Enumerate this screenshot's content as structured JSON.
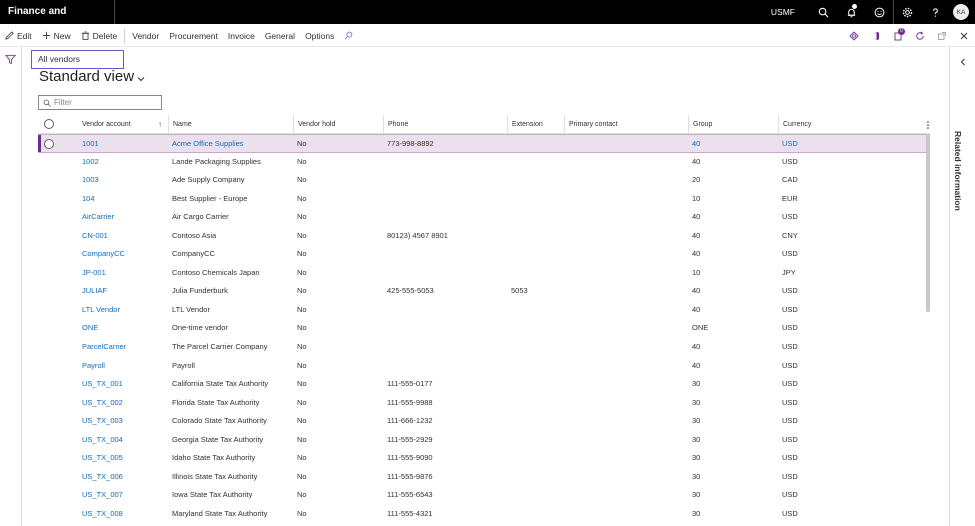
{
  "app": {
    "title": "Finance and Operations",
    "company": "USMF",
    "avatar_initials": "KA"
  },
  "actions": {
    "edit": "Edit",
    "new": "New",
    "delete": "Delete",
    "menus": [
      "Vendor",
      "Procurement",
      "Invoice",
      "General",
      "Options"
    ]
  },
  "view": {
    "name": "All vendors",
    "title": "Standard view",
    "filter_placeholder": "Filter"
  },
  "related_info": "Related information",
  "grid": {
    "columns": [
      "Vendor account",
      "Name",
      "Vendor hold",
      "Phone",
      "Extension",
      "Primary contact",
      "Group",
      "Currency"
    ],
    "rows": [
      {
        "account": "1001",
        "name": "Acme Office Supplies",
        "hold": "No",
        "phone": "773-998-8892",
        "ext": "",
        "contact": "",
        "group": "40",
        "currency": "USD"
      },
      {
        "account": "1002",
        "name": "Lande Packaging Supplies",
        "hold": "No",
        "phone": "",
        "ext": "",
        "contact": "",
        "group": "40",
        "currency": "USD"
      },
      {
        "account": "1003",
        "name": "Ade Supply Company",
        "hold": "No",
        "phone": "",
        "ext": "",
        "contact": "",
        "group": "20",
        "currency": "CAD"
      },
      {
        "account": "104",
        "name": "Best Supplier - Europe",
        "hold": "No",
        "phone": "",
        "ext": "",
        "contact": "",
        "group": "10",
        "currency": "EUR"
      },
      {
        "account": "AirCarrier",
        "name": "Air Cargo Carrier",
        "hold": "No",
        "phone": "",
        "ext": "",
        "contact": "",
        "group": "40",
        "currency": "USD"
      },
      {
        "account": "CN-001",
        "name": "Contoso Asia",
        "hold": "No",
        "phone": "80123) 4567 8901",
        "ext": "",
        "contact": "",
        "group": "40",
        "currency": "CNY"
      },
      {
        "account": "CompanyCC",
        "name": "CompanyCC",
        "hold": "No",
        "phone": "",
        "ext": "",
        "contact": "",
        "group": "40",
        "currency": "USD"
      },
      {
        "account": "JP-001",
        "name": "Contoso Chemicals Japan",
        "hold": "No",
        "phone": "",
        "ext": "",
        "contact": "",
        "group": "10",
        "currency": "JPY"
      },
      {
        "account": "JULIAF",
        "name": "Julia Funderburk",
        "hold": "No",
        "phone": "425-555-5053",
        "ext": "5053",
        "contact": "",
        "group": "40",
        "currency": "USD"
      },
      {
        "account": "LTL Vendor",
        "name": "LTL Vendor",
        "hold": "No",
        "phone": "",
        "ext": "",
        "contact": "",
        "group": "40",
        "currency": "USD"
      },
      {
        "account": "ONE",
        "name": "One-time vendor",
        "hold": "No",
        "phone": "",
        "ext": "",
        "contact": "",
        "group": "ONE",
        "currency": "USD"
      },
      {
        "account": "ParcelCarrier",
        "name": "The Parcel Carrier Company",
        "hold": "No",
        "phone": "",
        "ext": "",
        "contact": "",
        "group": "40",
        "currency": "USD"
      },
      {
        "account": "Payroll",
        "name": "Payroll",
        "hold": "No",
        "phone": "",
        "ext": "",
        "contact": "",
        "group": "40",
        "currency": "USD"
      },
      {
        "account": "US_TX_001",
        "name": "California State Tax Authority",
        "hold": "No",
        "phone": "111-555-0177",
        "ext": "",
        "contact": "",
        "group": "30",
        "currency": "USD"
      },
      {
        "account": "US_TX_002",
        "name": "Florida State Tax Authority",
        "hold": "No",
        "phone": "111-555-9988",
        "ext": "",
        "contact": "",
        "group": "30",
        "currency": "USD"
      },
      {
        "account": "US_TX_003",
        "name": "Colorado State Tax Authority",
        "hold": "No",
        "phone": "111-666-1232",
        "ext": "",
        "contact": "",
        "group": "30",
        "currency": "USD"
      },
      {
        "account": "US_TX_004",
        "name": "Georgia State Tax Authority",
        "hold": "No",
        "phone": "111-555-2929",
        "ext": "",
        "contact": "",
        "group": "30",
        "currency": "USD"
      },
      {
        "account": "US_TX_005",
        "name": "Idaho State Tax Authority",
        "hold": "No",
        "phone": "111-555-9090",
        "ext": "",
        "contact": "",
        "group": "30",
        "currency": "USD"
      },
      {
        "account": "US_TX_006",
        "name": "Illinois State Tax Authority",
        "hold": "No",
        "phone": "111-555-9876",
        "ext": "",
        "contact": "",
        "group": "30",
        "currency": "USD"
      },
      {
        "account": "US_TX_007",
        "name": "Iowa State Tax Authority",
        "hold": "No",
        "phone": "111-555-6543",
        "ext": "",
        "contact": "",
        "group": "30",
        "currency": "USD"
      },
      {
        "account": "US_TX_008",
        "name": "Maryland State Tax Authority",
        "hold": "No",
        "phone": "111-555-4321",
        "ext": "",
        "contact": "",
        "group": "30",
        "currency": "USD"
      }
    ]
  }
}
